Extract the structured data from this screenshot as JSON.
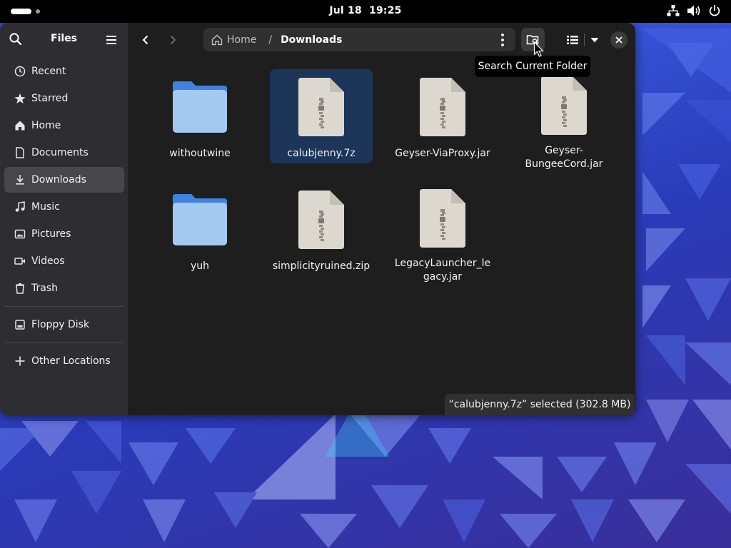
{
  "topbar": {
    "clock_date": "Jul 18",
    "clock_time": "19:25",
    "tray_icons": [
      "network-icon",
      "volume-icon",
      "power-icon"
    ]
  },
  "sidebar": {
    "title": "Files",
    "items": [
      {
        "label": "Recent",
        "icon": "clock-icon"
      },
      {
        "label": "Starred",
        "icon": "star-icon"
      },
      {
        "label": "Home",
        "icon": "home-icon"
      },
      {
        "label": "Documents",
        "icon": "document-icon"
      },
      {
        "label": "Downloads",
        "icon": "download-icon",
        "active": true
      },
      {
        "label": "Music",
        "icon": "music-icon"
      },
      {
        "label": "Pictures",
        "icon": "picture-icon"
      },
      {
        "label": "Videos",
        "icon": "video-icon"
      },
      {
        "label": "Trash",
        "icon": "trash-icon"
      }
    ],
    "devices": [
      {
        "label": "Floppy Disk",
        "icon": "drive-icon"
      }
    ],
    "other": [
      {
        "label": "Other Locations",
        "icon": "plus-icon"
      }
    ]
  },
  "pathbar": {
    "home": "Home",
    "separator": "/",
    "current": "Downloads"
  },
  "tooltip": "Search Current Folder",
  "files": [
    {
      "name": "withoutwine",
      "type": "folder"
    },
    {
      "name": "calubjenny.7z",
      "type": "archive",
      "selected": true
    },
    {
      "name": "Geyser-ViaProxy.jar",
      "type": "archive"
    },
    {
      "name": "Geyser-BungeeCord.jar",
      "type": "archive"
    },
    {
      "name": "yuh",
      "type": "folder"
    },
    {
      "name": "simplicityruined.zip",
      "type": "archive"
    },
    {
      "name": "LegacyLauncher_legacy.jar",
      "type": "archive"
    }
  ],
  "status": "“calubjenny.7z” selected  (302.8 MB)",
  "colors": {
    "accent": "#3584e4",
    "selection": "#1c3558",
    "folder": "#a4c8f0",
    "archive": "#ddd8cf"
  }
}
